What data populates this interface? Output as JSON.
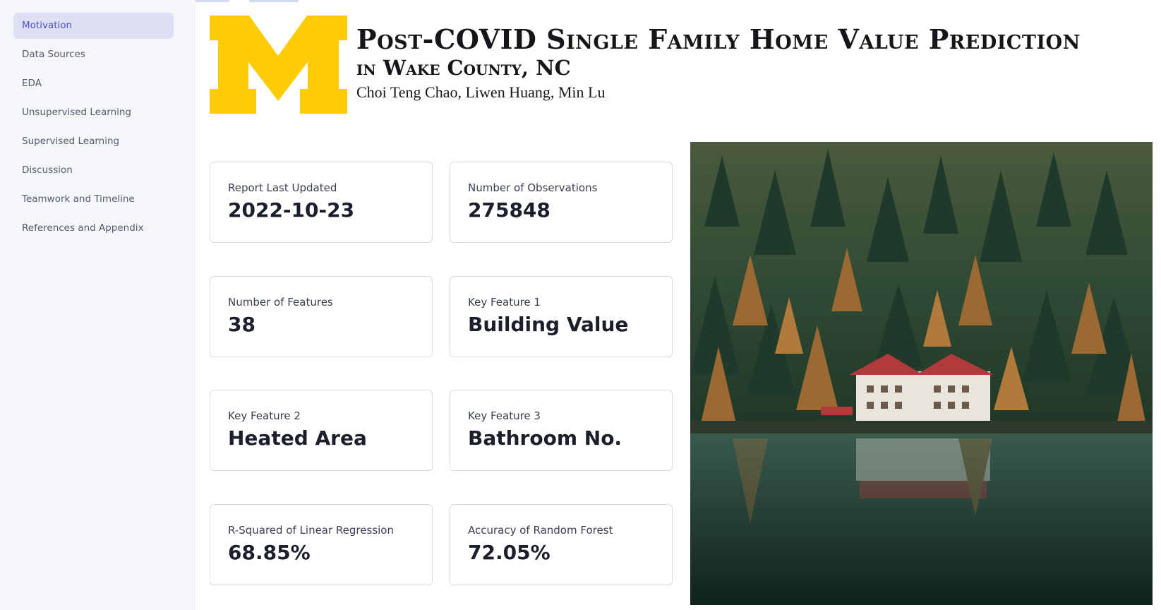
{
  "sidebar": {
    "items": [
      {
        "label": "Motivation",
        "active": true
      },
      {
        "label": "Data Sources",
        "active": false
      },
      {
        "label": "EDA",
        "active": false
      },
      {
        "label": "Unsupervised Learning",
        "active": false
      },
      {
        "label": "Supervised Learning",
        "active": false
      },
      {
        "label": "Discussion",
        "active": false
      },
      {
        "label": "Teamwork and Timeline",
        "active": false
      },
      {
        "label": "References and Appendix",
        "active": false
      }
    ]
  },
  "header": {
    "logo_letter": "M",
    "logo_color": "#FFCB05",
    "title": "Post-COVID Single Family Home Value Prediction",
    "subtitle": "in Wake County, NC",
    "authors": "Choi Teng Chao, Liwen Huang, Min Lu"
  },
  "metrics": [
    {
      "label": "Report Last Updated",
      "value": "2022-10-23"
    },
    {
      "label": "Number of Observations",
      "value": "275848"
    },
    {
      "label": "Number of Features",
      "value": "38"
    },
    {
      "label": "Key Feature 1",
      "value": "Building Value"
    },
    {
      "label": "Key Feature 2",
      "value": "Heated Area"
    },
    {
      "label": "Key Feature 3",
      "value": "Bathroom No."
    },
    {
      "label": "R-Squared of Linear Regression",
      "value": "68.85%"
    },
    {
      "label": "Accuracy of Random Forest",
      "value": "72.05%"
    }
  ],
  "theme": {
    "active_nav_bg": "#dfe0f5",
    "active_nav_text": "#4a4fc8",
    "sidebar_bg": "#f5f6f9"
  }
}
